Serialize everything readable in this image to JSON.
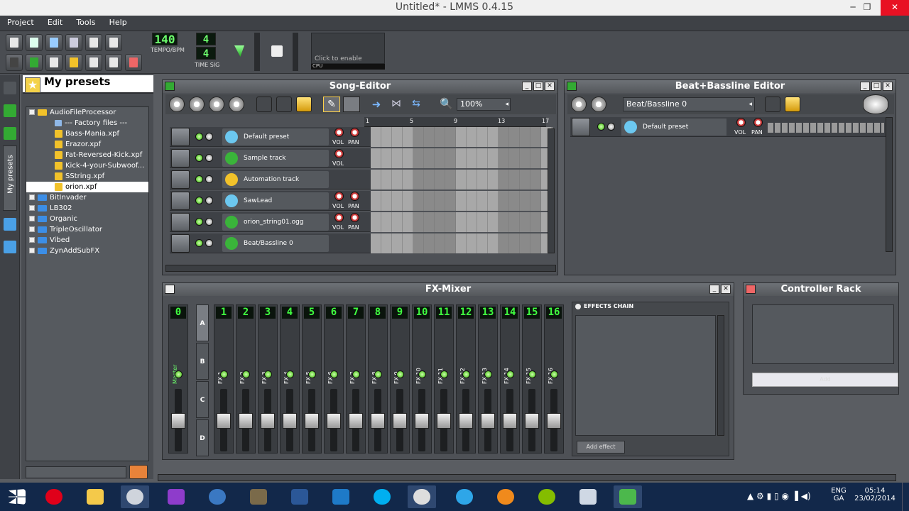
{
  "window": {
    "title": "Untitled* - LMMS 0.4.15",
    "min": "─",
    "max": "❐",
    "close": "✕"
  },
  "menu": [
    "Project",
    "Edit",
    "Tools",
    "Help"
  ],
  "toolbar": {
    "tempo_value": "140",
    "tempo_label": "TEMPO/BPM",
    "timesig_num": "4",
    "timesig_den": "4",
    "timesig_label": "TIME SIG",
    "cpu_hint": "Click to enable",
    "cpu_label": "CPU"
  },
  "browser": {
    "title": "My presets",
    "side_tab": "My presets",
    "items": [
      {
        "label": "AudioFileProcessor",
        "kind": "folder-open",
        "indent": 0
      },
      {
        "label": "--- Factory files ---",
        "kind": "file",
        "indent": 2
      },
      {
        "label": "Bass-Mania.xpf",
        "kind": "preset",
        "indent": 2
      },
      {
        "label": "Erazor.xpf",
        "kind": "preset",
        "indent": 2
      },
      {
        "label": "Fat-Reversed-Kick.xpf",
        "kind": "preset",
        "indent": 2
      },
      {
        "label": "Kick-4-your-Subwoof...",
        "kind": "preset",
        "indent": 2
      },
      {
        "label": "SString.xpf",
        "kind": "preset",
        "indent": 2
      },
      {
        "label": "orion.xpf",
        "kind": "preset-selected",
        "indent": 2
      },
      {
        "label": "BitInvader",
        "kind": "folder",
        "indent": 0
      },
      {
        "label": "LB302",
        "kind": "folder",
        "indent": 0
      },
      {
        "label": "Organic",
        "kind": "folder",
        "indent": 0
      },
      {
        "label": "TripleOscillator",
        "kind": "folder",
        "indent": 0
      },
      {
        "label": "Vibed",
        "kind": "folder",
        "indent": 0
      },
      {
        "label": "ZynAddSubFX",
        "kind": "folder",
        "indent": 0
      }
    ]
  },
  "song_editor": {
    "title": "Song-Editor",
    "zoom": "100%",
    "ruler": [
      "1",
      "5",
      "9",
      "13",
      "17"
    ],
    "vol": "VOL",
    "pan": "PAN",
    "tracks": [
      {
        "name": "Default preset",
        "vol": true,
        "pan": true,
        "color": "#6cc8f0"
      },
      {
        "name": "Sample track",
        "vol": true,
        "pan": false,
        "color": "#3ab43a"
      },
      {
        "name": "Automation track",
        "vol": false,
        "pan": false,
        "color": "#f2c22a"
      },
      {
        "name": "SawLead",
        "vol": true,
        "pan": true,
        "color": "#6cc8f0"
      },
      {
        "name": "orion_string01.ogg",
        "vol": true,
        "pan": true,
        "color": "#3ab43a"
      },
      {
        "name": "Beat/Bassline 0",
        "vol": false,
        "pan": false,
        "color": "#3ab43a"
      }
    ]
  },
  "beat_editor": {
    "title": "Beat+Bassline Editor",
    "selected": "Beat/Bassline 0",
    "track_name": "Default preset",
    "vol": "VOL",
    "pan": "PAN"
  },
  "fx_mixer": {
    "title": "FX-Mixer",
    "channels": [
      {
        "num": "0",
        "name": "Master"
      },
      {
        "num": "1",
        "name": "FX 1"
      },
      {
        "num": "2",
        "name": "FX 2"
      },
      {
        "num": "3",
        "name": "FX 3"
      },
      {
        "num": "4",
        "name": "FX 4"
      },
      {
        "num": "5",
        "name": "FX 5"
      },
      {
        "num": "6",
        "name": "FX 6"
      },
      {
        "num": "7",
        "name": "FX 7"
      },
      {
        "num": "8",
        "name": "FX 8"
      },
      {
        "num": "9",
        "name": "FX 9"
      },
      {
        "num": "10",
        "name": "FX 10"
      },
      {
        "num": "11",
        "name": "FX 11"
      },
      {
        "num": "12",
        "name": "FX 12"
      },
      {
        "num": "13",
        "name": "FX 13"
      },
      {
        "num": "14",
        "name": "FX 14"
      },
      {
        "num": "15",
        "name": "FX 15"
      },
      {
        "num": "16",
        "name": "FX 16"
      }
    ],
    "banks": [
      "A",
      "B",
      "C",
      "D"
    ],
    "effects_chain": "EFFECTS CHAIN",
    "add_effect": "Add effect"
  },
  "controller_rack": {
    "title": "Controller Rack",
    "add": "Add"
  },
  "tray": {
    "lang1": "ENG",
    "lang2": "GA",
    "time": "05:14",
    "date": "23/02/2014"
  },
  "colors": {
    "lcd_green": "#6cff6c",
    "folder_blue": "#3c8ee6",
    "folder_yellow": "#f2c22a",
    "taskbar": "#12284a"
  }
}
